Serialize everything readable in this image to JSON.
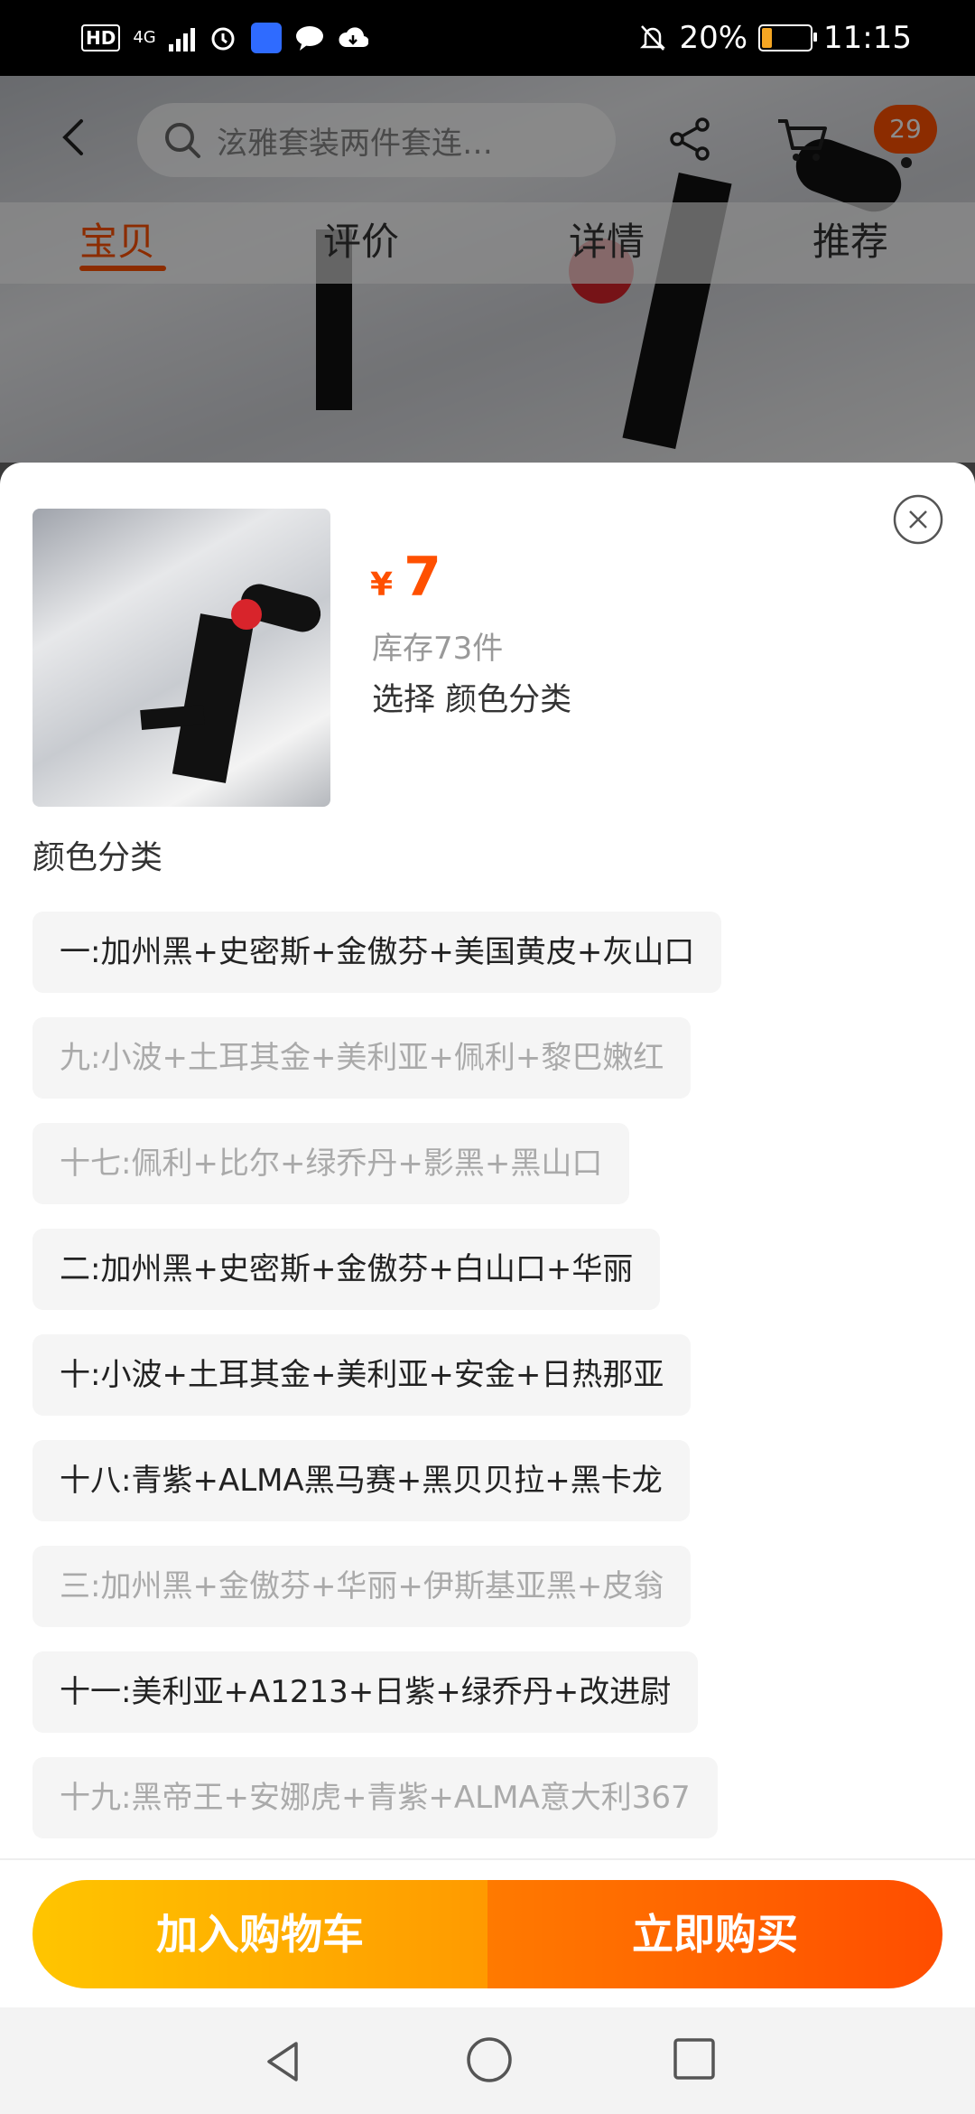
{
  "status_bar": {
    "left_badges": [
      "HD",
      "4G"
    ],
    "battery_text": "20%",
    "time": "11:15"
  },
  "header": {
    "search_text": "泫雅套装两件套连…",
    "cart_badge": "29"
  },
  "tabs": [
    {
      "label": "宝贝",
      "active": true
    },
    {
      "label": "评价",
      "active": false
    },
    {
      "label": "详情",
      "active": false
    },
    {
      "label": "推荐",
      "active": false
    }
  ],
  "sheet": {
    "currency": "¥",
    "price": "7",
    "stock": "库存73件",
    "select_text": "选择 颜色分类",
    "section_title": "颜色分类",
    "options": [
      {
        "label": "一:加州黑+史密斯+金傲芬+美国黄皮+灰山口",
        "enabled": true
      },
      {
        "label": "九:小波+土耳其金+美利亚+佩利+黎巴嫩红",
        "enabled": false
      },
      {
        "label": "十七:佩利+比尔+绿乔丹+影黑+黑山口",
        "enabled": false
      },
      {
        "label": "二:加州黑+史密斯+金傲芬+白山口+华丽",
        "enabled": true
      },
      {
        "label": "十:小波+土耳其金+美利亚+安金+日热那亚",
        "enabled": true
      },
      {
        "label": "十八:青紫+ALMA黑马赛+黑贝贝拉+黑卡龙",
        "enabled": true
      },
      {
        "label": "三:加州黑+金傲芬+华丽+伊斯基亚黑+皮翁",
        "enabled": false
      },
      {
        "label": "十一:美利亚+A1213+日紫+绿乔丹+改进尉",
        "enabled": true
      },
      {
        "label": "十九:黑帝王+安娜虎+青紫+ALMA意大利367",
        "enabled": false
      }
    ],
    "add_to_cart": "加入购物车",
    "buy_now": "立即购买"
  },
  "colors": {
    "accent": "#ff5000",
    "cart_gradient": [
      "#ffc500",
      "#ff9a00"
    ],
    "buy_gradient": [
      "#ff7a00",
      "#ff4d00"
    ]
  }
}
